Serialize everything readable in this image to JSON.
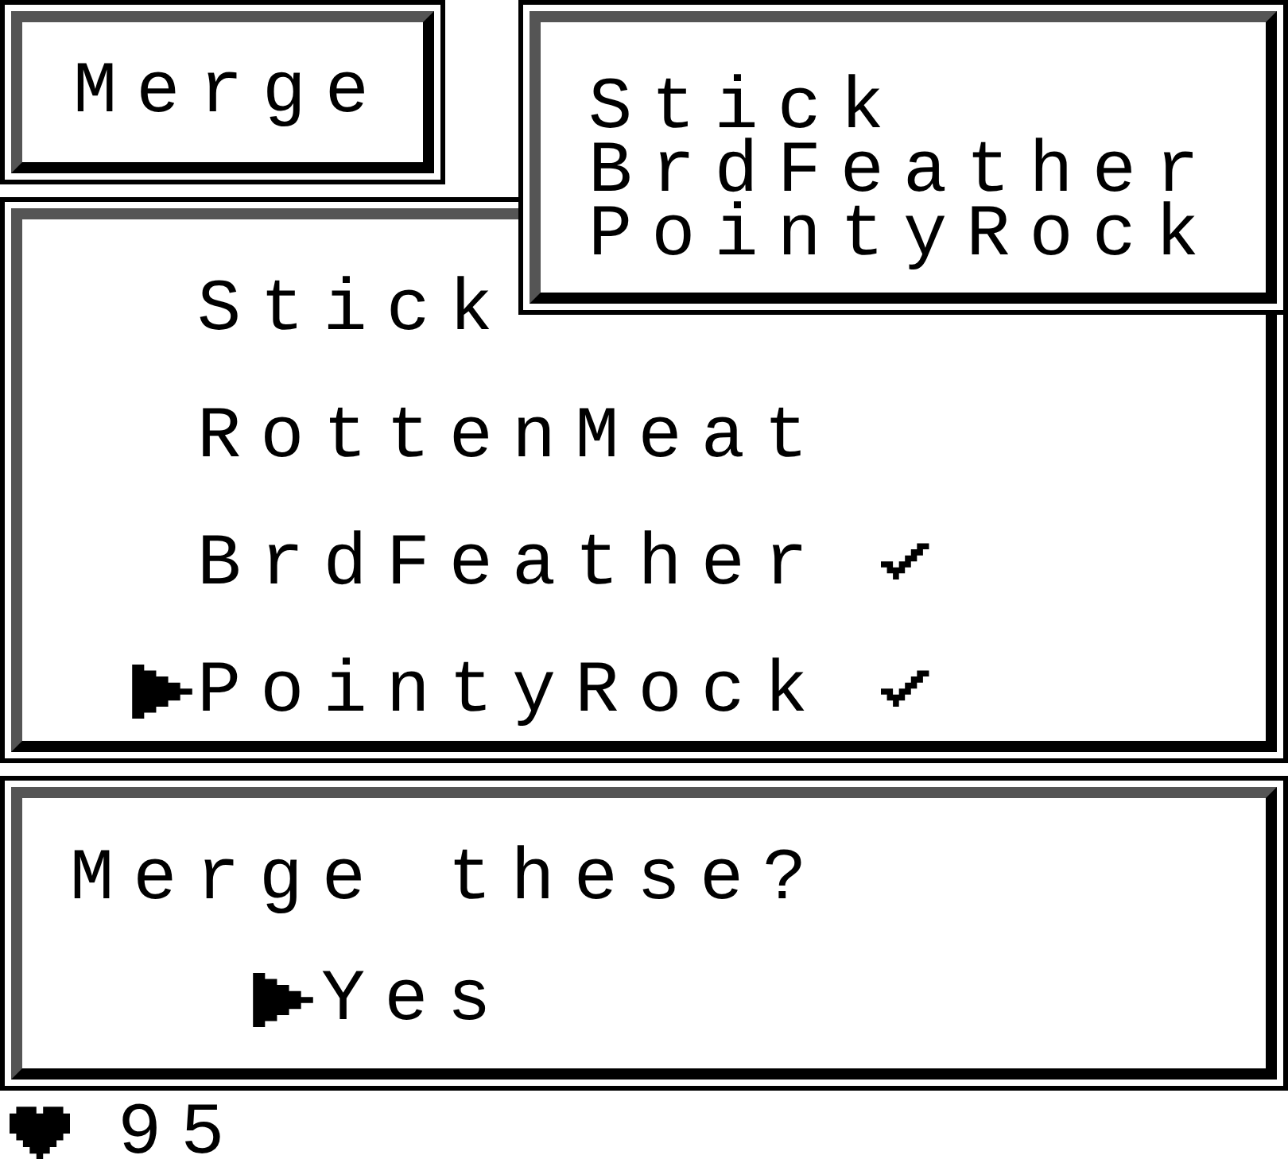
{
  "mode_label": "Merge",
  "picked": [
    "Stick",
    "BrdFeather",
    "PointyRock"
  ],
  "items": [
    {
      "label": "Stick",
      "selected": false,
      "checked": false
    },
    {
      "label": "RottenMeat",
      "selected": false,
      "checked": false
    },
    {
      "label": "BrdFeather",
      "selected": false,
      "checked": true
    },
    {
      "label": "PointyRock",
      "selected": true,
      "checked": true
    }
  ],
  "prompt": {
    "text": "Merge these?",
    "options": [
      {
        "label": "Yes",
        "selected": true
      }
    ]
  },
  "status": {
    "hp": "95"
  }
}
